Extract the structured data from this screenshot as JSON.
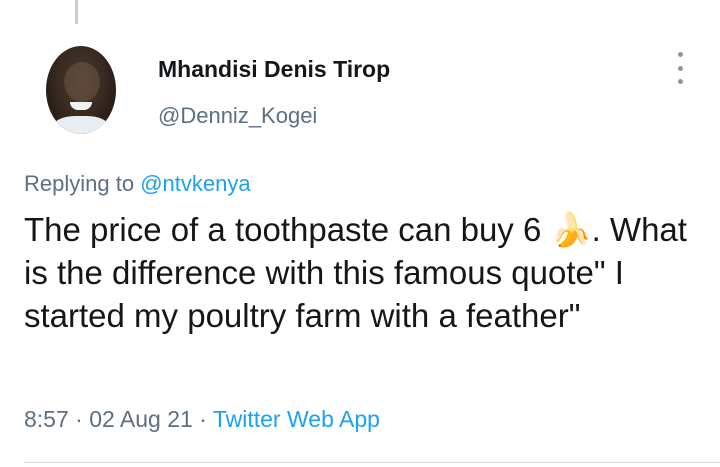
{
  "author": {
    "name": "Mhandisi Denis Tirop",
    "handle": "@Denniz_Kogei"
  },
  "reply": {
    "prefix": "Replying to ",
    "to": "@ntvkenya"
  },
  "tweet": {
    "text": "The price of a toothpaste can buy 6 🍌. What is the difference with this famous quote\" I started my poultry farm with a feather\""
  },
  "meta": {
    "time": "8:57",
    "sep1": " · ",
    "date": "02 Aug 21",
    "sep2": " · ",
    "source": "Twitter Web App"
  },
  "colors": {
    "link": "#1da1f2",
    "secondary": "#5b7083",
    "text": "#14171a"
  },
  "icons": {
    "more": "more-vertical-icon"
  }
}
